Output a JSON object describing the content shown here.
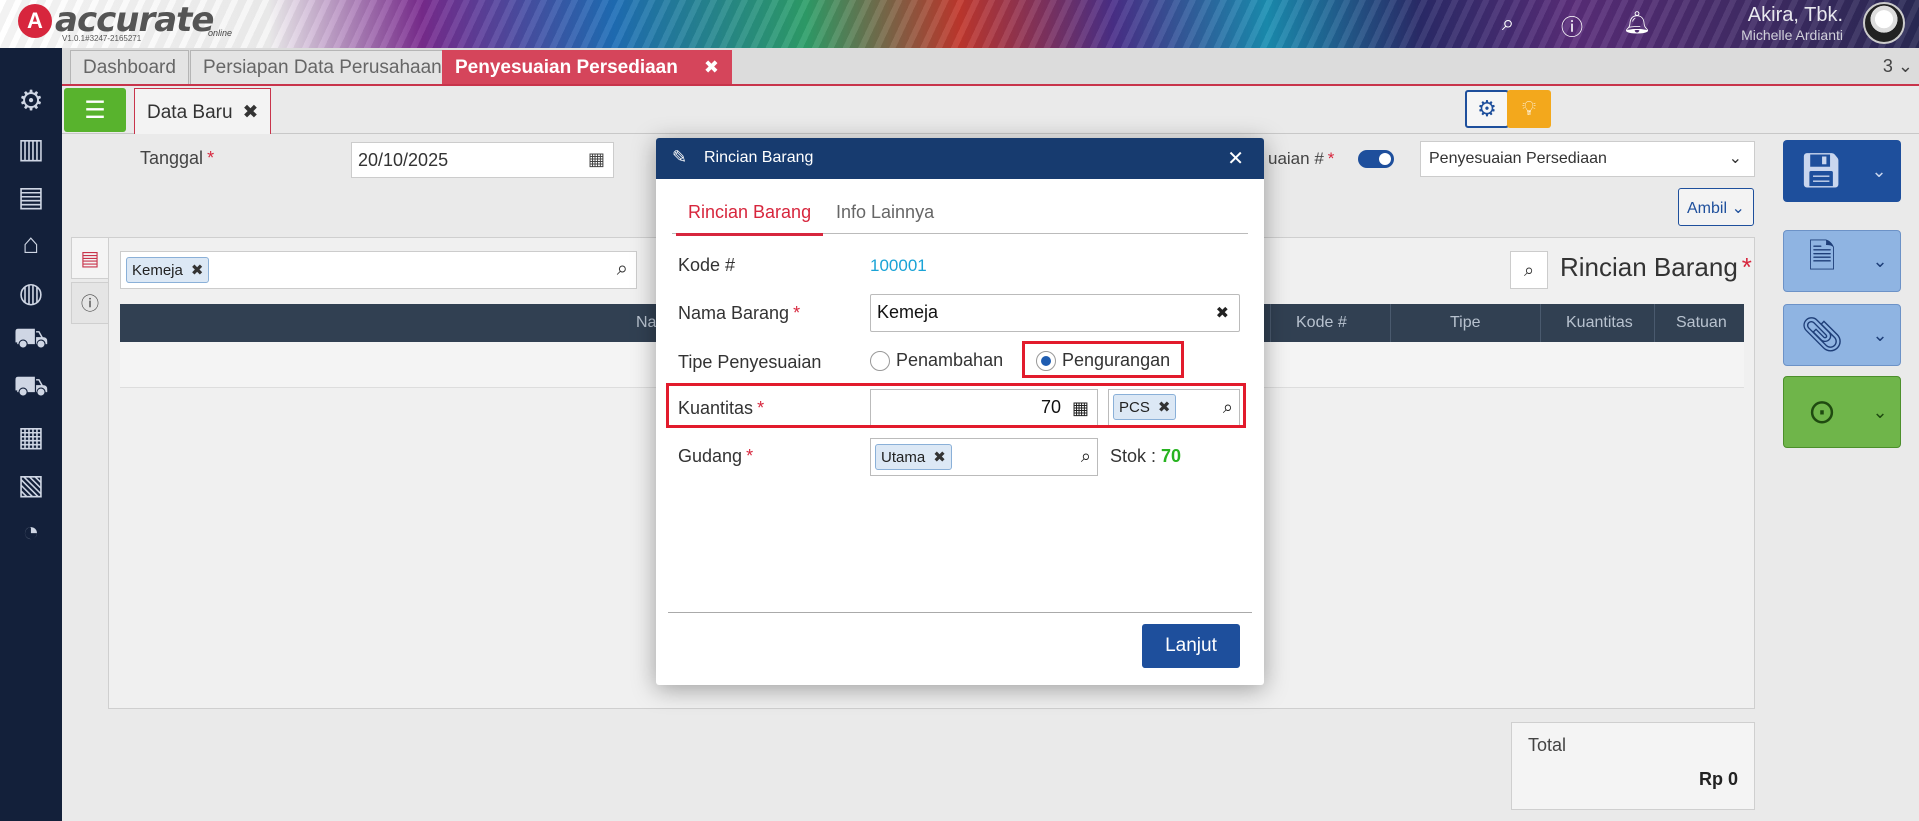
{
  "header": {
    "logo_letter": "A",
    "logo_text": "accurate",
    "logo_sub": "online",
    "version": "V1.0.1#3247-2165271",
    "user_name": "Akira, Tbk.",
    "user_role": "Michelle Ardianti"
  },
  "tabs": [
    {
      "label": "Dashboard"
    },
    {
      "label": "Persiapan Data Perusahaan"
    },
    {
      "label": "Penyesuaian Persediaan",
      "close": "✖"
    }
  ],
  "tab_count": "3 ⌄",
  "subbar": {
    "data_baru_label": "Data Baru",
    "close": "✖"
  },
  "form": {
    "tanggal_label": "Tanggal",
    "tanggal_value": "20/10/2025",
    "penyesuaian_label": "uaian #",
    "tipe_select_value": "Penyesuaian Persediaan",
    "ambil_label": "Ambil ⌄",
    "required_mark": "*"
  },
  "item_search": {
    "chip": "Kemeja"
  },
  "grid": {
    "title": "Rincian Barang",
    "columns": [
      "Na",
      "Kode #",
      "Tipe",
      "Kuantitas",
      "Satuan"
    ]
  },
  "total": {
    "label": "Total",
    "value": "Rp 0"
  },
  "modal": {
    "title": "Rincian Barang",
    "tabs": [
      "Rincian Barang",
      "Info Lainnya"
    ],
    "kode_label": "Kode #",
    "kode_value": "100001",
    "nama_label": "Nama Barang",
    "nama_value": "Kemeja",
    "tipe_label": "Tipe Penyesuaian",
    "tipe_options": [
      "Penambahan",
      "Pengurangan"
    ],
    "tipe_selected": "Pengurangan",
    "kuantitas_label": "Kuantitas",
    "kuantitas_value": "70",
    "satuan_chip": "PCS",
    "gudang_label": "Gudang",
    "gudang_chip": "Utama",
    "stok_label": "Stok :",
    "stok_value": "70",
    "lanjut_label": "Lanjut"
  },
  "colors": {
    "accent_red": "#d5455b",
    "navy": "#173b6f",
    "primary_blue": "#1e4f9c",
    "highlight_box": "#e21b2c",
    "stock_green": "#27b320"
  }
}
